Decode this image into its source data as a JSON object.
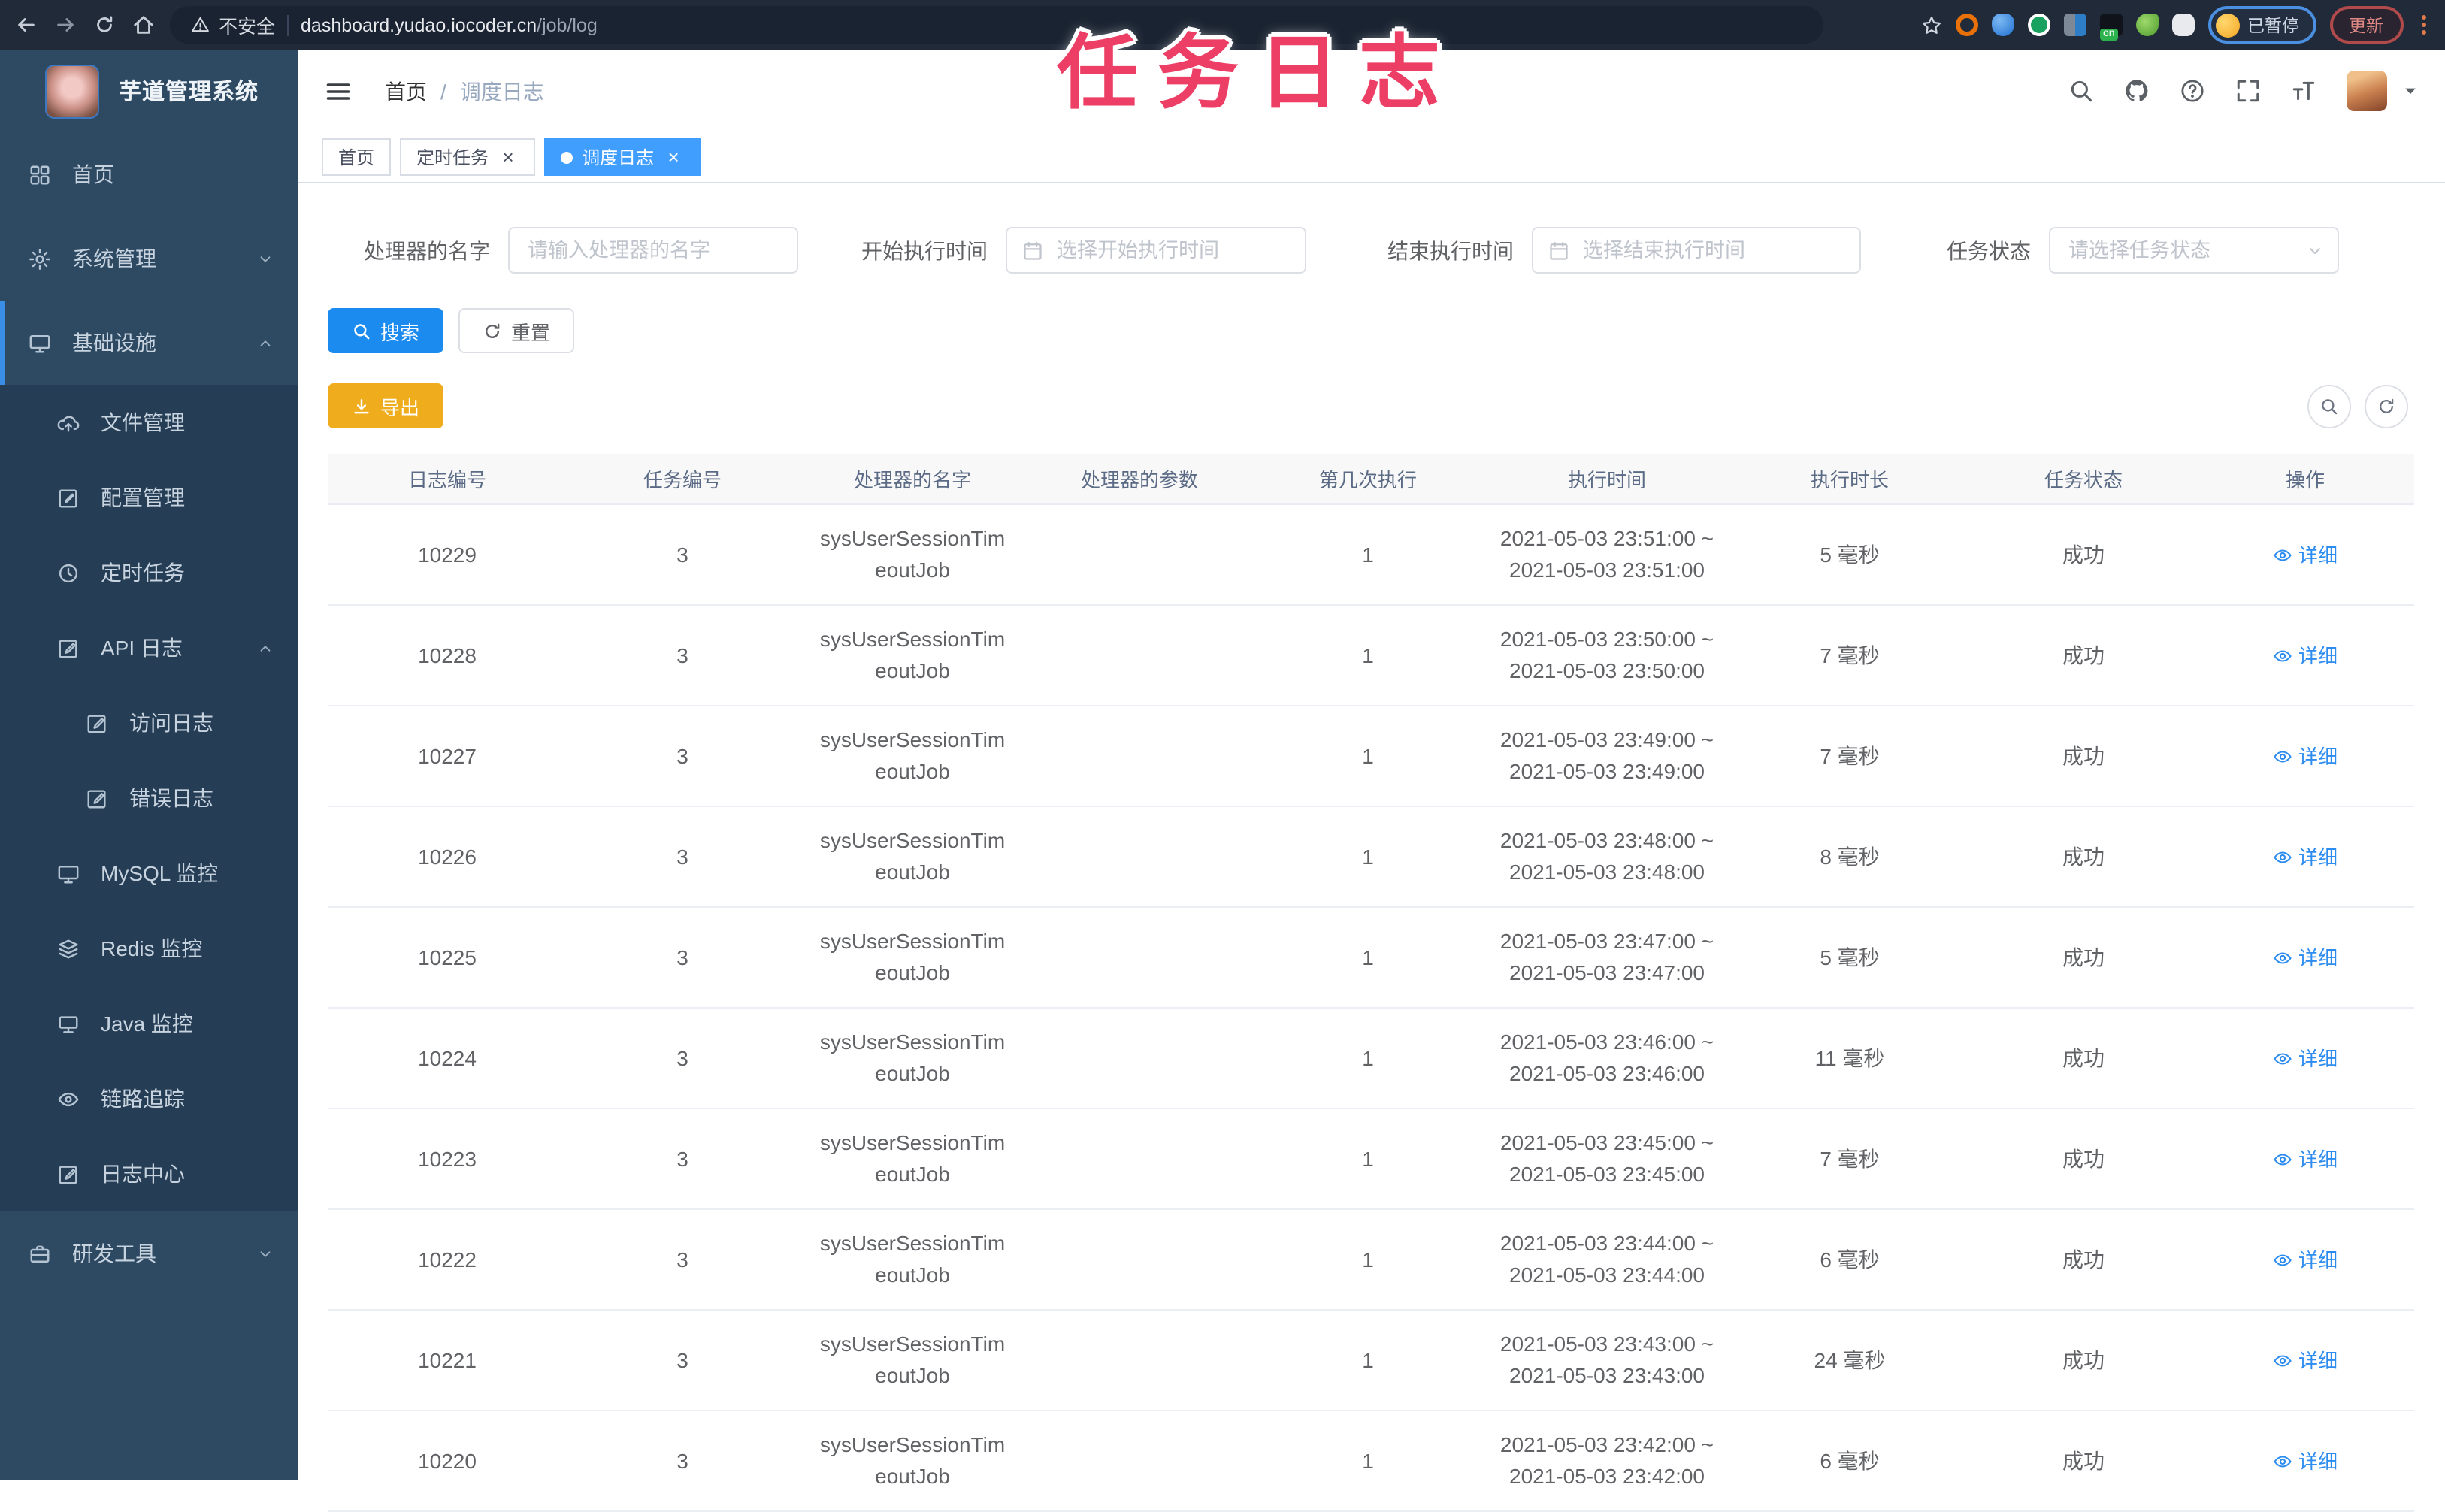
{
  "annotation": {
    "text": "任务日志",
    "color": "#ed3f66"
  },
  "browser": {
    "security_label": "不安全",
    "url_domain": "dashboard.yudao.iocoder.cn",
    "url_path": "/job/log",
    "paused_badge": "已暂停",
    "update_label": "更新"
  },
  "sidebar": {
    "app_title": "芋道管理系统",
    "items": [
      {
        "id": "home",
        "label": "首页",
        "icon": "dashboard-icon",
        "level": 1,
        "section": "top"
      },
      {
        "id": "system-management",
        "label": "系统管理",
        "icon": "gear-icon",
        "level": 1,
        "chevron": "chevron-down-icon",
        "section": "top"
      },
      {
        "id": "infrastructure",
        "label": "基础设施",
        "icon": "monitor-icon",
        "level": 1,
        "chevron": "chevron-up-icon",
        "section": "active"
      },
      {
        "id": "file-management",
        "label": "文件管理",
        "icon": "cloud-upload-icon",
        "level": 2,
        "submenu": true,
        "section": "active"
      },
      {
        "id": "config-management",
        "label": "配置管理",
        "icon": "edit-icon",
        "level": 2,
        "submenu": true,
        "section": "active"
      },
      {
        "id": "scheduled-tasks",
        "label": "定时任务",
        "icon": "clock-icon",
        "level": 2,
        "submenu": true,
        "section": "active"
      },
      {
        "id": "api-logs",
        "label": "API 日志",
        "icon": "log-icon",
        "level": 2,
        "submenu": true,
        "chevron": "chevron-up-icon",
        "section": "active"
      },
      {
        "id": "access-logs",
        "label": "访问日志",
        "icon": "log-icon",
        "level": 3,
        "submenu": true,
        "section": "active"
      },
      {
        "id": "error-logs",
        "label": "错误日志",
        "icon": "log-icon",
        "level": 3,
        "submenu": true,
        "section": "active"
      },
      {
        "id": "mysql-monitor",
        "label": "MySQL 监控",
        "icon": "monitor-icon",
        "level": 2,
        "submenu": true,
        "section": "active"
      },
      {
        "id": "redis-monitor",
        "label": "Redis 监控",
        "icon": "layers-icon",
        "level": 2,
        "submenu": true,
        "section": "active"
      },
      {
        "id": "java-monitor",
        "label": "Java 监控",
        "icon": "pc-icon",
        "level": 2,
        "submenu": true,
        "section": "active"
      },
      {
        "id": "trace",
        "label": "链路追踪",
        "icon": "eye-icon",
        "level": 2,
        "submenu": true,
        "section": "active"
      },
      {
        "id": "log-center",
        "label": "日志中心",
        "icon": "log-icon",
        "level": 2,
        "submenu": true,
        "section": "active"
      },
      {
        "id": "dev-tools",
        "label": "研发工具",
        "icon": "toolbox-icon",
        "level": 1,
        "chevron": "chevron-down-icon",
        "section": "bottom"
      }
    ]
  },
  "header": {
    "breadcrumb": {
      "items": [
        "首页",
        "调度日志"
      ],
      "separator": "/"
    }
  },
  "tabs": [
    {
      "label": "首页",
      "active": false,
      "closable": false
    },
    {
      "label": "定时任务",
      "active": false,
      "closable": true
    },
    {
      "label": "调度日志",
      "active": true,
      "closable": true
    }
  ],
  "filters": [
    {
      "label": "处理器的名字",
      "placeholder": "请输入处理器的名字",
      "type": "text"
    },
    {
      "label": "开始执行时间",
      "placeholder": "选择开始执行时间",
      "type": "date"
    },
    {
      "label": "结束执行时间",
      "placeholder": "选择结束执行时间",
      "type": "date"
    },
    {
      "label": "任务状态",
      "placeholder": "请选择任务状态",
      "type": "select"
    }
  ],
  "actions": {
    "search": "搜索",
    "reset": "重置",
    "export": "导出"
  },
  "colors": {
    "primary": "#409eff",
    "warning": "#efad1d",
    "annotation": "#ed3f66"
  },
  "table": {
    "columns": [
      "日志编号",
      "任务编号",
      "处理器的名字",
      "处理器的参数",
      "第几次执行",
      "执行时间",
      "执行时长",
      "任务状态",
      "操作"
    ],
    "detail_label": "详细",
    "rows": [
      {
        "log_id": "10229",
        "job_id": "3",
        "handler": [
          "sysUserSessionTim",
          "eoutJob"
        ],
        "param": "",
        "execute_index": "1",
        "time_range": [
          "2021-05-03 23:51:00 ~",
          "2021-05-03 23:51:00"
        ],
        "duration": "5 毫秒",
        "status": "成功"
      },
      {
        "log_id": "10228",
        "job_id": "3",
        "handler": [
          "sysUserSessionTim",
          "eoutJob"
        ],
        "param": "",
        "execute_index": "1",
        "time_range": [
          "2021-05-03 23:50:00 ~",
          "2021-05-03 23:50:00"
        ],
        "duration": "7 毫秒",
        "status": "成功"
      },
      {
        "log_id": "10227",
        "job_id": "3",
        "handler": [
          "sysUserSessionTim",
          "eoutJob"
        ],
        "param": "",
        "execute_index": "1",
        "time_range": [
          "2021-05-03 23:49:00 ~",
          "2021-05-03 23:49:00"
        ],
        "duration": "7 毫秒",
        "status": "成功"
      },
      {
        "log_id": "10226",
        "job_id": "3",
        "handler": [
          "sysUserSessionTim",
          "eoutJob"
        ],
        "param": "",
        "execute_index": "1",
        "time_range": [
          "2021-05-03 23:48:00 ~",
          "2021-05-03 23:48:00"
        ],
        "duration": "8 毫秒",
        "status": "成功"
      },
      {
        "log_id": "10225",
        "job_id": "3",
        "handler": [
          "sysUserSessionTim",
          "eoutJob"
        ],
        "param": "",
        "execute_index": "1",
        "time_range": [
          "2021-05-03 23:47:00 ~",
          "2021-05-03 23:47:00"
        ],
        "duration": "5 毫秒",
        "status": "成功"
      },
      {
        "log_id": "10224",
        "job_id": "3",
        "handler": [
          "sysUserSessionTim",
          "eoutJob"
        ],
        "param": "",
        "execute_index": "1",
        "time_range": [
          "2021-05-03 23:46:00 ~",
          "2021-05-03 23:46:00"
        ],
        "duration": "11 毫秒",
        "status": "成功"
      },
      {
        "log_id": "10223",
        "job_id": "3",
        "handler": [
          "sysUserSessionTim",
          "eoutJob"
        ],
        "param": "",
        "execute_index": "1",
        "time_range": [
          "2021-05-03 23:45:00 ~",
          "2021-05-03 23:45:00"
        ],
        "duration": "7 毫秒",
        "status": "成功"
      },
      {
        "log_id": "10222",
        "job_id": "3",
        "handler": [
          "sysUserSessionTim",
          "eoutJob"
        ],
        "param": "",
        "execute_index": "1",
        "time_range": [
          "2021-05-03 23:44:00 ~",
          "2021-05-03 23:44:00"
        ],
        "duration": "6 毫秒",
        "status": "成功"
      },
      {
        "log_id": "10221",
        "job_id": "3",
        "handler": [
          "sysUserSessionTim",
          "eoutJob"
        ],
        "param": "",
        "execute_index": "1",
        "time_range": [
          "2021-05-03 23:43:00 ~",
          "2021-05-03 23:43:00"
        ],
        "duration": "24 毫秒",
        "status": "成功"
      },
      {
        "log_id": "10220",
        "job_id": "3",
        "handler": [
          "sysUserSessionTim",
          "eoutJob"
        ],
        "param": "",
        "execute_index": "1",
        "time_range": [
          "2021-05-03 23:42:00 ~",
          "2021-05-03 23:42:00"
        ],
        "duration": "6 毫秒",
        "status": "成功"
      }
    ]
  }
}
